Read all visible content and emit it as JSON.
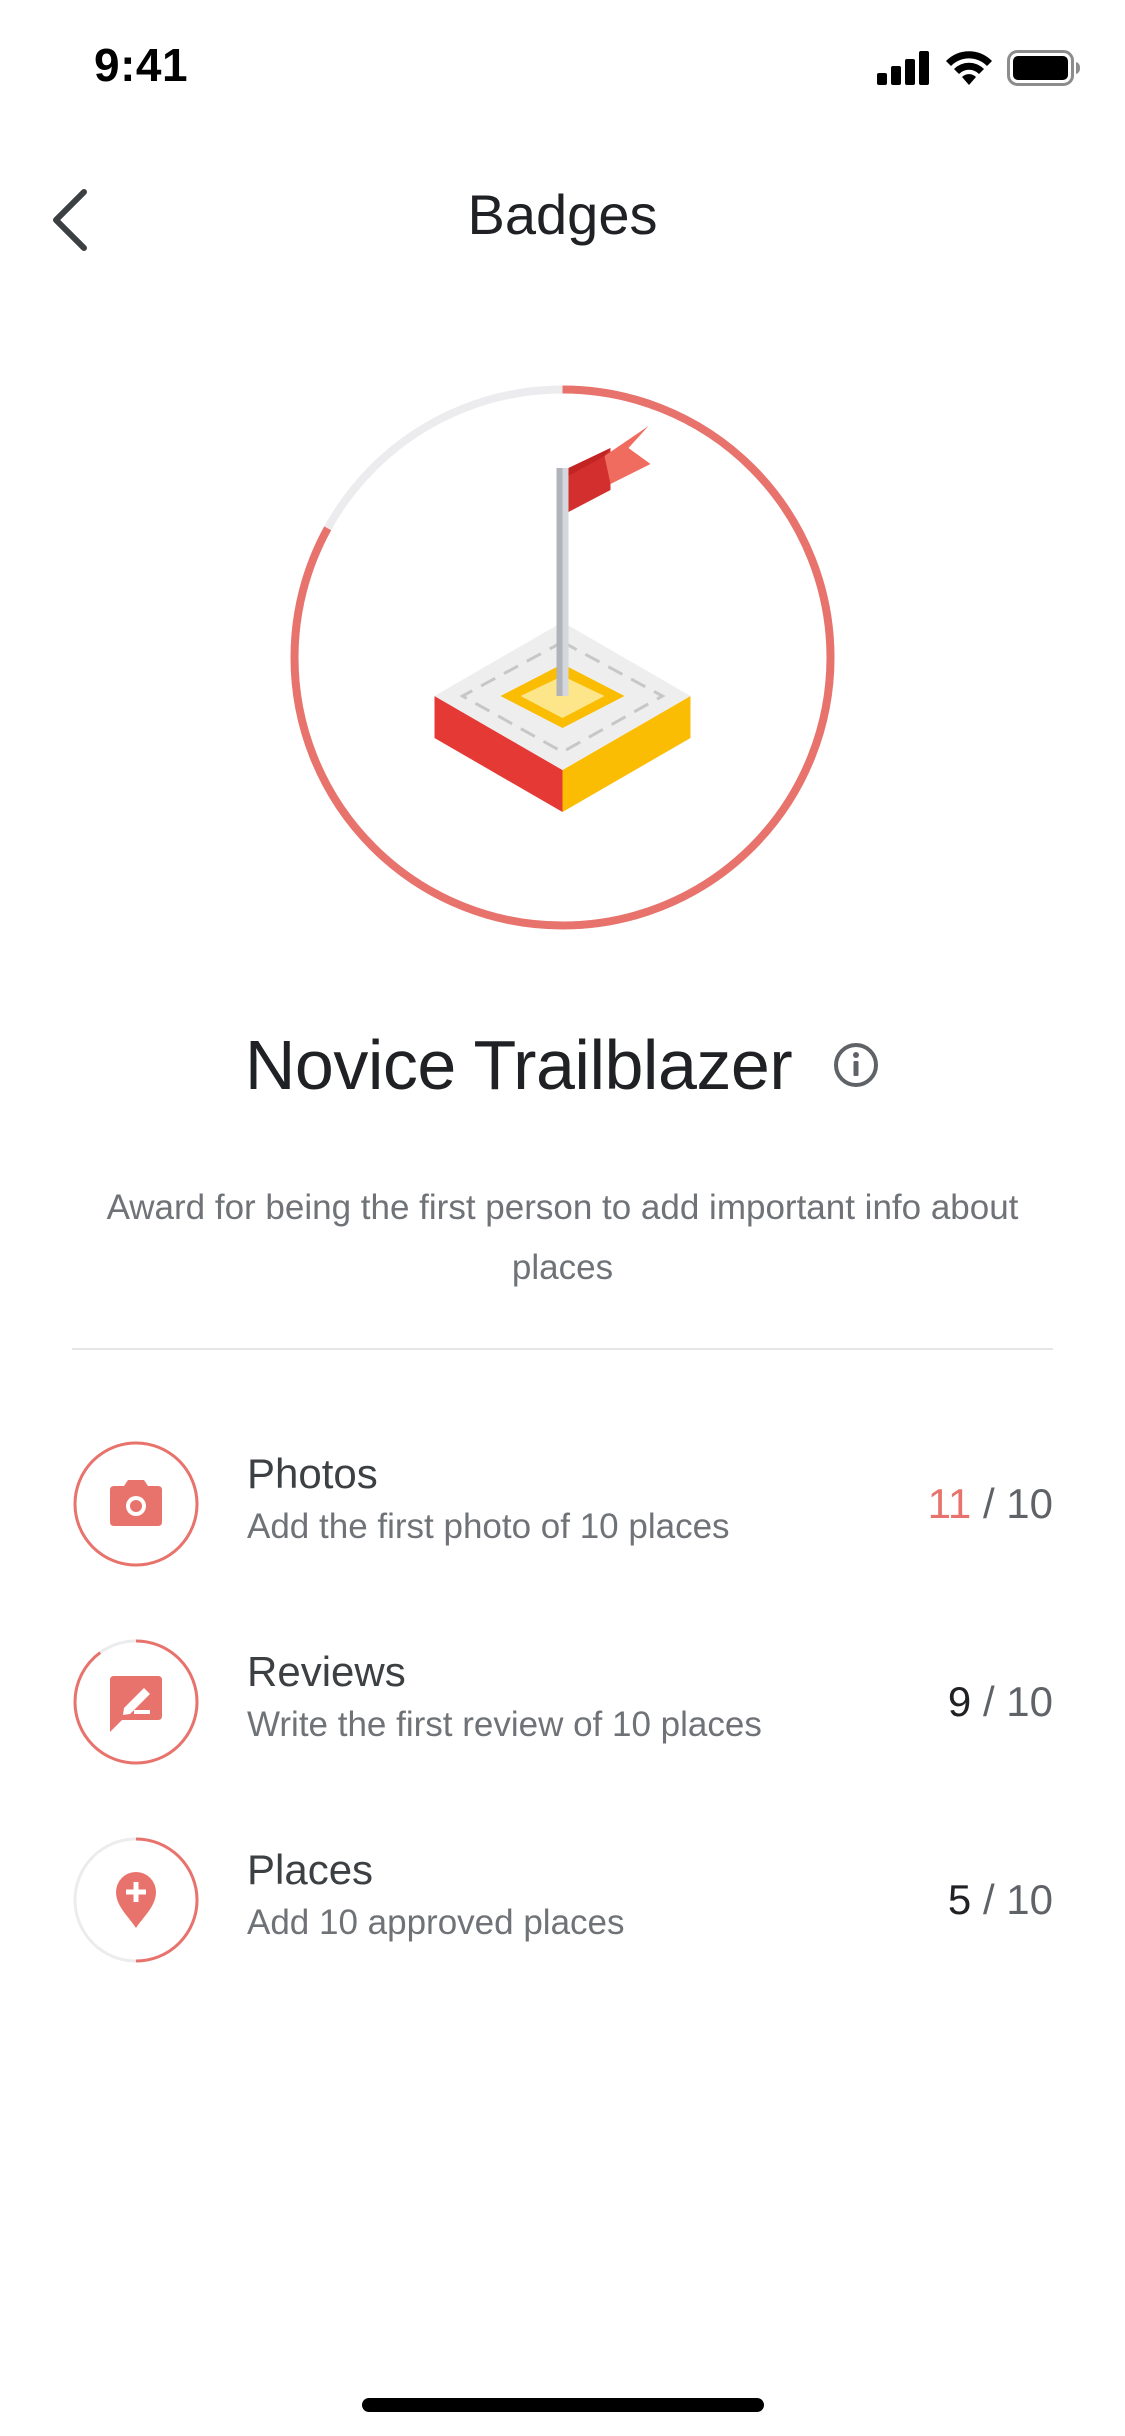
{
  "status_bar": {
    "time": "9:41",
    "icons": [
      "cellular-signal-icon",
      "wifi-icon",
      "battery-icon"
    ]
  },
  "nav": {
    "title": "Badges",
    "back_icon": "chevron-left-icon"
  },
  "badge": {
    "name": "Novice Trailblazer",
    "description": "Award for being the first person to add important info about places",
    "progress": 0.83,
    "illustration": "flag-on-platform",
    "info_icon": "info-icon"
  },
  "requirements": [
    {
      "title": "Photos",
      "subtitle": "Add the first photo of 10 places",
      "count": "11",
      "separator": "/",
      "goal": "10",
      "progress": 1.0,
      "completed": true,
      "icon": "camera-icon"
    },
    {
      "title": "Reviews",
      "subtitle": "Write the first review of 10 places",
      "count": "9",
      "separator": "/",
      "goal": "10",
      "progress": 0.9,
      "completed": false,
      "icon": "review-edit-icon"
    },
    {
      "title": "Places",
      "subtitle": "Add 10 approved places",
      "count": "5",
      "separator": "/",
      "goal": "10",
      "progress": 0.5,
      "completed": false,
      "icon": "add-place-pin-icon"
    }
  ],
  "colors": {
    "accent": "#e8736c",
    "track": "#ececef",
    "text_primary": "#202124",
    "text_secondary": "#6f7276"
  }
}
